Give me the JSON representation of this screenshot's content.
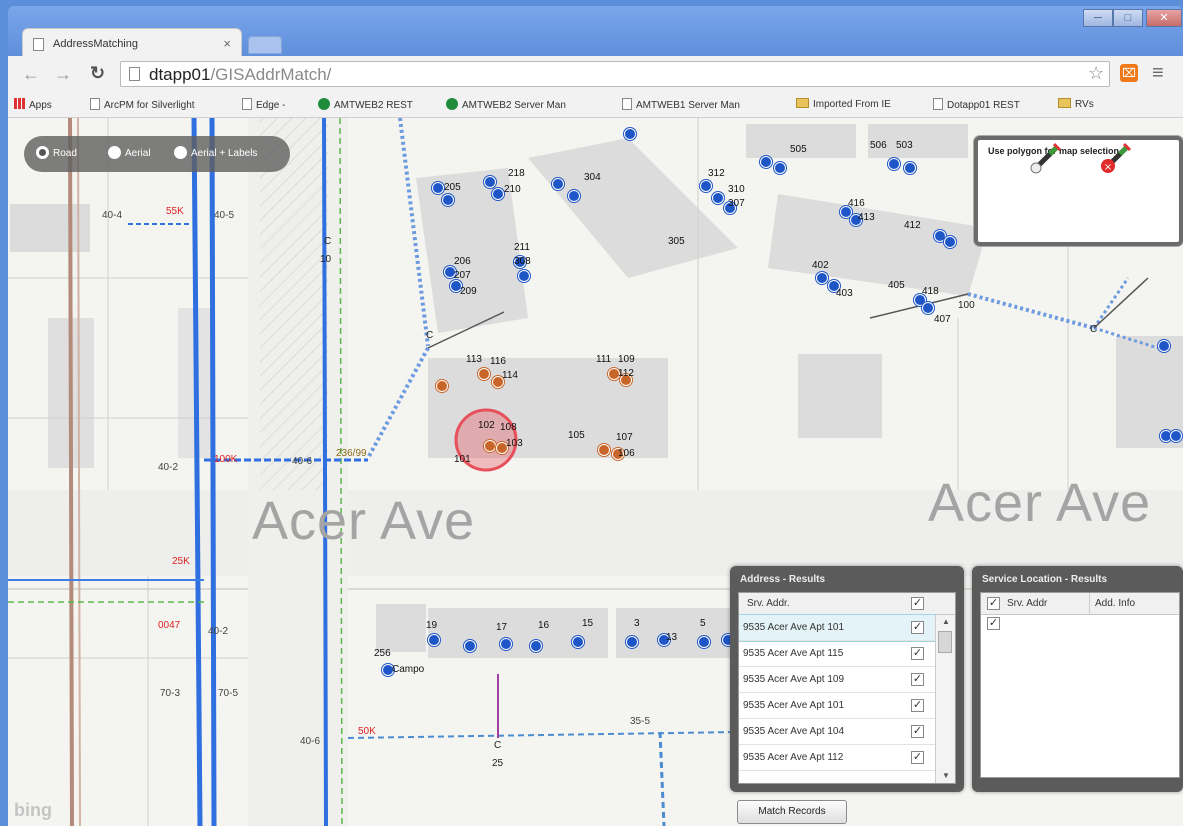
{
  "browser": {
    "tab_title": "AddressMatching",
    "tab_close": "×",
    "url_host": "dtapp01",
    "url_path": "/GISAddrMatch/",
    "window_controls": [
      "─",
      "□",
      "✕"
    ],
    "bookmarks": [
      {
        "label": "Apps",
        "icon": "apps-icon"
      },
      {
        "label": "ArcPM for Silverlight",
        "icon": "page-icon"
      },
      {
        "label": "Edge -",
        "icon": "page-icon"
      },
      {
        "label": "AMTWEB2 REST",
        "icon": "globe-icon"
      },
      {
        "label": "AMTWEB2 Server Man",
        "icon": "globe-icon"
      },
      {
        "label": "AMTWEB1 Server Man",
        "icon": "page-icon"
      },
      {
        "label": "Imported From IE",
        "icon": "folder-icon"
      },
      {
        "label": "Dotapp01 REST",
        "icon": "page-icon"
      },
      {
        "label": "RVs",
        "icon": "folder-icon"
      }
    ]
  },
  "map": {
    "basemap_options": [
      {
        "label": "Road",
        "selected": true
      },
      {
        "label": "Aerial",
        "selected": false
      },
      {
        "label": "Aerial + Labels",
        "selected": false
      }
    ],
    "street_labels": [
      "Acer Ave",
      "Acer Ave"
    ],
    "polygon_panel_title": "Use polygon for map selection.",
    "watermark": "bing",
    "labels": {
      "service_40_4": "40-4",
      "transformer_55k": "55K",
      "pole_40_5": "40-5",
      "pole_c10": "C",
      "pole_10": "10",
      "pole_40_2": "40-2",
      "transformer_100k": "100K",
      "pole_40_6": "40-6",
      "pole_236_99": "236/99",
      "pole_25k": "25K",
      "pole_40_2b": "40-2",
      "p_0047": "0047",
      "pole_70_3": "70-3",
      "pole_70_5": "70-5",
      "transformer_50k": "50K",
      "pole_40_6b": "40-6",
      "pole_c25": "C",
      "pole_25": "25",
      "pole_35_5": "35-5",
      "pole_c50": "C",
      "pole_c_top": "C",
      "pole_c_right": "C",
      "pole_100": "100",
      "addr_113": "113",
      "addr_116": "116",
      "addr_114": "114",
      "addr_111": "111",
      "addr_109": "109",
      "addr_112": "112",
      "addr_102": "102",
      "addr_108": "108",
      "addr_101": "101",
      "addr_103": "103",
      "addr_105": "105",
      "addr_107": "107",
      "addr_106": "106",
      "addr_218": "218",
      "addr_210": "210",
      "addr_205": "205",
      "addr_206": "206",
      "addr_207": "207",
      "addr_209": "209",
      "addr_211": "211",
      "addr_308": "308",
      "addr_304": "304",
      "addr_312": "312",
      "addr_310": "310",
      "addr_307": "307",
      "addr_305": "305",
      "addr_506": "506",
      "addr_503": "503",
      "addr_505": "505",
      "addr_416": "416",
      "addr_413": "413",
      "addr_412": "412",
      "addr_402": "402",
      "addr_403": "403",
      "addr_405": "405",
      "addr_418": "418",
      "addr_407": "407",
      "addr_3": "3",
      "addr_19": "19",
      "addr_17": "17",
      "addr_16": "16",
      "addr_15": "15",
      "addr_13": "13",
      "addr_5": "5",
      "addr_campo": "Campo",
      "addr_256": "256"
    }
  },
  "address_results": {
    "title": "Address - Results",
    "header": "Srv. Addr.",
    "rows": [
      {
        "addr": "9535 Acer Ave Apt 101",
        "checked": true,
        "selected": true
      },
      {
        "addr": "9535 Acer Ave Apt 115",
        "checked": true,
        "selected": false
      },
      {
        "addr": "9535 Acer Ave Apt 109",
        "checked": true,
        "selected": false
      },
      {
        "addr": "9535 Acer Ave Apt 101",
        "checked": true,
        "selected": false
      },
      {
        "addr": "9535 Acer Ave Apt 104",
        "checked": true,
        "selected": false
      },
      {
        "addr": "9535 Acer Ave Apt 112",
        "checked": true,
        "selected": false
      }
    ]
  },
  "service_results": {
    "title": "Service Location - Results",
    "headers": [
      "Srv. Addr",
      "Add. Info"
    ]
  },
  "actions": {
    "match_button": "Match Records"
  },
  "colors": {
    "title_bar": "#6c98e0",
    "primary_line": "#2f6fe0",
    "secondary_line": "#4a8bd1",
    "meter_blue": "#1e56c8",
    "meter_orange": "#c8662a",
    "highlight": "#e7505a",
    "panel": "#5b5b5b"
  }
}
